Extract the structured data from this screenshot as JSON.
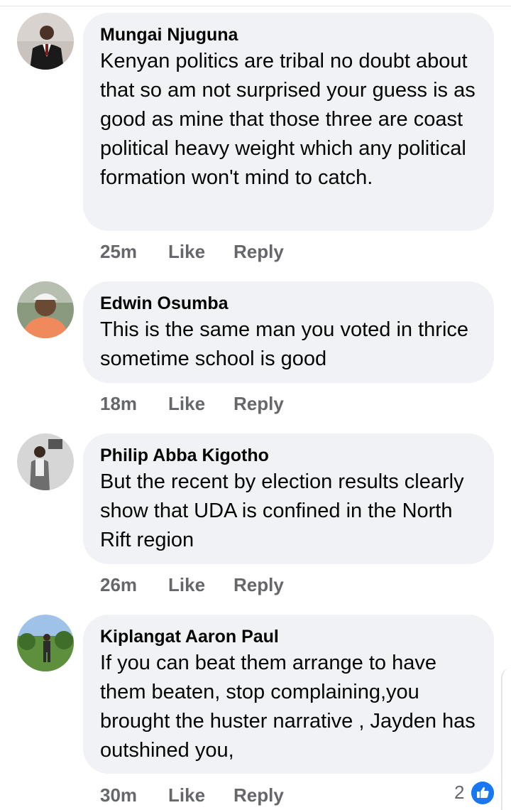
{
  "comments": [
    {
      "author": "Mungai Njuguna",
      "text": "Kenyan politics are tribal no doubt about that so am not surprised your guess is as good as mine that those three are coast political heavy weight which any political formation won't mind to catch.",
      "time": "25m",
      "like_label": "Like",
      "reply_label": "Reply"
    },
    {
      "author": "Edwin Osumba",
      "text": "This is the same man you voted in thrice sometime school is good",
      "time": "18m",
      "like_label": "Like",
      "reply_label": "Reply"
    },
    {
      "author": "Philip Abba Kigotho",
      "text": "But the recent by election results clearly show that UDA is confined in the North Rift region",
      "time": "26m",
      "like_label": "Like",
      "reply_label": "Reply"
    },
    {
      "author": "Kiplangat Aaron Paul",
      "text": "If you can beat them arrange to have them beaten, stop complaining,you brought the huster narrative , Jayden has outshined you,",
      "time": "30m",
      "like_label": "Like",
      "reply_label": "Reply",
      "reaction_count": "2",
      "reaction_icon": "like-thumb-icon"
    }
  ],
  "colors": {
    "bubble": "#f0f2f5",
    "text": "#050505",
    "meta": "#65676b",
    "like_blue": "#1877f2"
  }
}
